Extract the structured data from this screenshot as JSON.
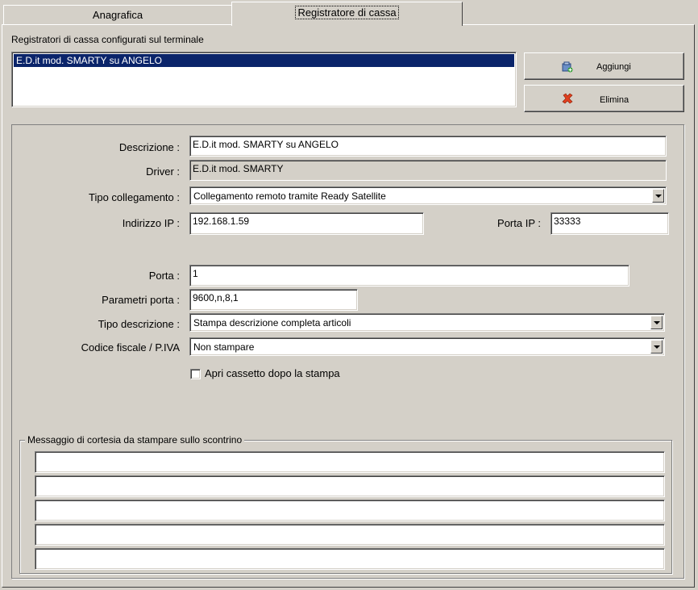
{
  "tabs": [
    {
      "label": "Anagrafica",
      "active": false
    },
    {
      "label": "Registratore di cassa",
      "active": true
    }
  ],
  "list": {
    "title": "Registratori di cassa configurati sul terminale",
    "items": [
      "E.D.it mod. SMARTY su ANGELO"
    ]
  },
  "buttons": {
    "add": "Aggiungi",
    "delete": "Elimina"
  },
  "form": {
    "descrizione_label": "Descrizione :",
    "descrizione_value": "E.D.it mod. SMARTY su ANGELO",
    "driver_label": "Driver :",
    "driver_value": "E.D.it mod. SMARTY",
    "tipo_collegamento_label": "Tipo collegamento :",
    "tipo_collegamento_value": "Collegamento remoto tramite Ready Satellite",
    "indirizzo_ip_label": "Indirizzo IP :",
    "indirizzo_ip_value": "192.168.1.59",
    "porta_ip_label": "Porta IP :",
    "porta_ip_value": "33333",
    "porta_label": "Porta :",
    "porta_value": "1",
    "parametri_porta_label": "Parametri porta :",
    "parametri_porta_value": "9600,n,8,1",
    "tipo_descrizione_label": "Tipo descrizione :",
    "tipo_descrizione_value": "Stampa descrizione completa articoli",
    "codice_fiscale_label": "Codice fiscale / P.IVA",
    "codice_fiscale_value": "Non stampare",
    "apri_cassetto_label": "Apri cassetto dopo la stampa",
    "apri_cassetto_checked": false
  },
  "messaggio": {
    "title": "Messaggio di cortesia da stampare sullo scontrino",
    "lines": [
      "",
      "",
      "",
      "",
      ""
    ]
  },
  "colors": {
    "selection": "#0a246a",
    "background": "#d4d0c8"
  }
}
